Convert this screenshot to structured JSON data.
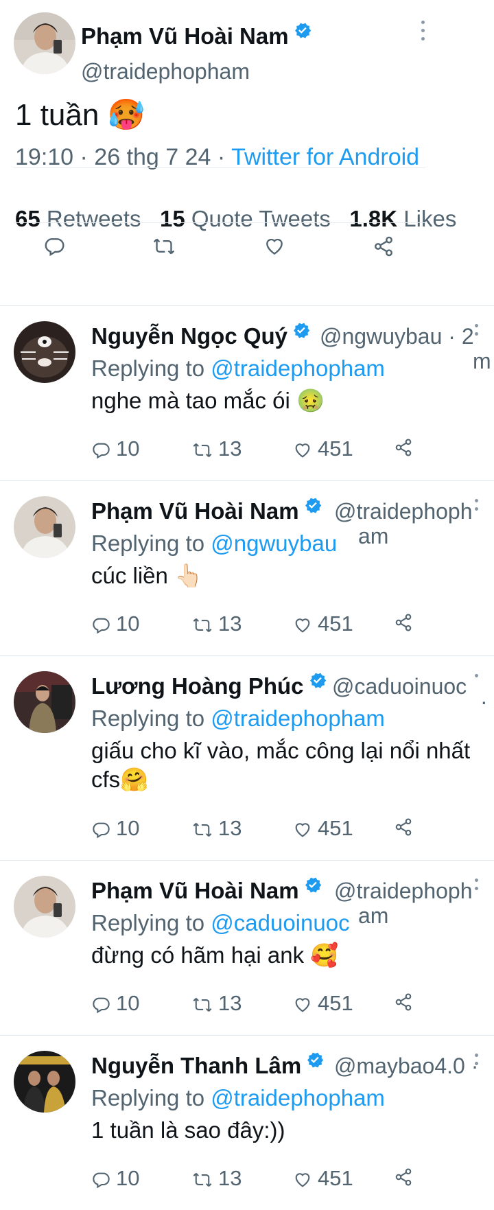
{
  "tweet": {
    "name": "Phạm Vũ Hoài Nam",
    "handle": "@traidephopham",
    "text": "1 tuần 🥵",
    "time": "19:10 · 26 thg 7 24 · ",
    "app": "Twitter for Android",
    "retweets_count": "65",
    "retweets_label": "Retweets",
    "quotes_count": "15",
    "quotes_label": "Quote Tweets",
    "likes_count": "1.8K",
    "likes_label": "Likes"
  },
  "replies": [
    {
      "name": "Nguyễn Ngọc Quý",
      "handle": "@ngwuybau · 2",
      "handle2": "m",
      "reply_prefix": "Replying to ",
      "reply_to": "@traidephopham",
      "text": "nghe mà tao mắc ói 🤢",
      "reply_count": "10",
      "retweet_count": "13",
      "like_count": "451"
    },
    {
      "name": "Phạm Vũ Hoài Nam",
      "handle": "@traidephoph",
      "handle2": "am",
      "reply_prefix": "Replying to ",
      "reply_to": "@ngwuybau",
      "text": "cúc liền 👆🏻",
      "reply_count": "10",
      "retweet_count": "13",
      "like_count": "451"
    },
    {
      "name": "Lương Hoàng Phúc",
      "handle": "@caduoinuoc",
      "handle2": "·",
      "reply_prefix": "Replying to ",
      "reply_to": "@traidephopham",
      "text": "giấu cho kĩ vào, mắc công lại nổi nhất cfs🤗",
      "reply_count": "10",
      "retweet_count": "13",
      "like_count": "451"
    },
    {
      "name": "Phạm Vũ Hoài Nam",
      "handle": "@traidephoph",
      "handle2": "am",
      "reply_prefix": "Replying to ",
      "reply_to": "@caduoinuoc",
      "text": "đừng có hãm hại ank 🥰",
      "reply_count": "10",
      "retweet_count": "13",
      "like_count": "451"
    },
    {
      "name": "Nguyễn Thanh Lâm",
      "handle": "@maybao4.0 ·",
      "handle2": "",
      "reply_prefix": "Replying to ",
      "reply_to": "@traidephopham",
      "text": "1 tuần là sao đây:))",
      "reply_count": "10",
      "retweet_count": "13",
      "like_count": "451"
    }
  ],
  "colors": {
    "accent": "#1d9bf0",
    "muted": "#536471",
    "text": "#0f1419"
  }
}
